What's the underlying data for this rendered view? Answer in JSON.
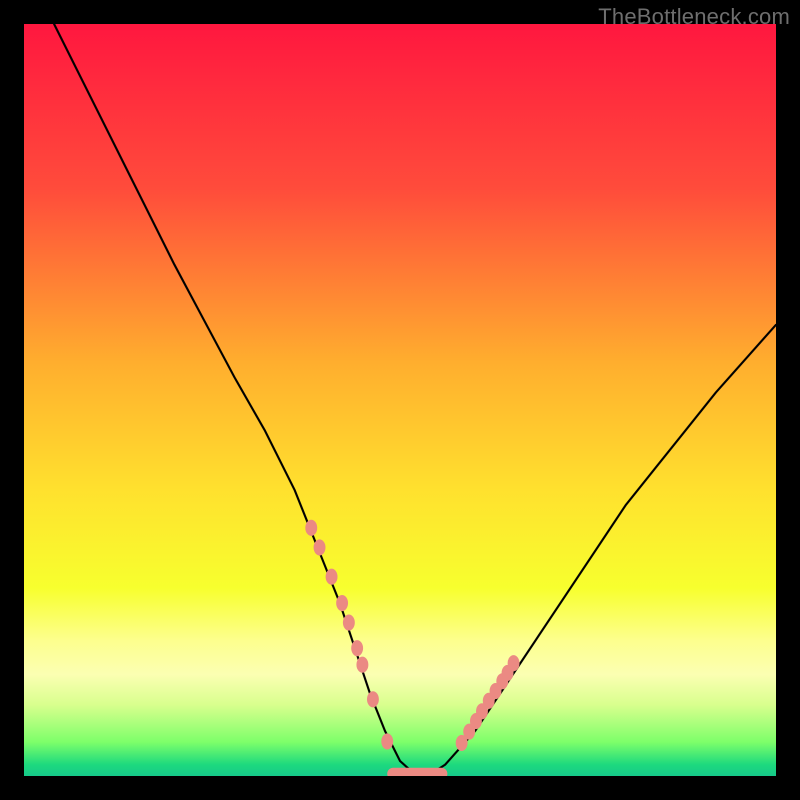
{
  "watermark": "TheBottleneck.com",
  "chart_data": {
    "type": "line",
    "title": "",
    "xlabel": "",
    "ylabel": "",
    "xlim": [
      0,
      100
    ],
    "ylim": [
      0,
      100
    ],
    "background_gradient": {
      "stops": [
        {
          "offset": 0.0,
          "color": "#ff173f"
        },
        {
          "offset": 0.22,
          "color": "#ff4c3b"
        },
        {
          "offset": 0.45,
          "color": "#ffae2e"
        },
        {
          "offset": 0.62,
          "color": "#ffe12e"
        },
        {
          "offset": 0.75,
          "color": "#f7ff2e"
        },
        {
          "offset": 0.82,
          "color": "#fdff8e"
        },
        {
          "offset": 0.865,
          "color": "#fbffb2"
        },
        {
          "offset": 0.905,
          "color": "#d9ff8e"
        },
        {
          "offset": 0.955,
          "color": "#7dff6a"
        },
        {
          "offset": 0.985,
          "color": "#1dd97e"
        },
        {
          "offset": 1.0,
          "color": "#16c98a"
        }
      ]
    },
    "series": [
      {
        "name": "bottleneck-curve",
        "type": "line",
        "color": "#000000",
        "stroke_width": 2,
        "x": [
          4,
          8,
          12,
          16,
          20,
          24,
          28,
          32,
          36,
          38,
          40,
          42,
          44,
          46,
          48,
          50,
          52,
          54,
          56,
          60,
          64,
          68,
          72,
          76,
          80,
          84,
          88,
          92,
          96,
          100
        ],
        "y": [
          100,
          92,
          84,
          76,
          68,
          60.5,
          53,
          46,
          38,
          33,
          28,
          23,
          17,
          11,
          6,
          2,
          0.2,
          0.2,
          1.5,
          6,
          12,
          18,
          24,
          30,
          36,
          41,
          46,
          51,
          55.5,
          60
        ]
      },
      {
        "name": "left-markers",
        "type": "scatter",
        "color": "#eb8a83",
        "marker_size": 14,
        "x": [
          38.2,
          39.3,
          40.9,
          42.3,
          43.2,
          44.3,
          45.0,
          46.4,
          48.3
        ],
        "y": [
          33.0,
          30.4,
          26.5,
          23.0,
          20.4,
          17.0,
          14.8,
          10.2,
          4.6
        ]
      },
      {
        "name": "right-markers",
        "type": "scatter",
        "color": "#eb8a83",
        "marker_size": 14,
        "x": [
          58.2,
          59.2,
          60.1,
          60.9,
          61.8,
          62.7,
          63.6,
          64.3,
          65.1
        ],
        "y": [
          4.4,
          5.9,
          7.3,
          8.6,
          10.0,
          11.3,
          12.6,
          13.7,
          15.0
        ]
      },
      {
        "name": "bottom-bar",
        "type": "scatter",
        "marker": "rounded-rect",
        "color": "#eb8a83",
        "x": [
          52.3
        ],
        "y": [
          0.3
        ],
        "width_x": 8.0,
        "height_y": 1.6
      }
    ]
  }
}
